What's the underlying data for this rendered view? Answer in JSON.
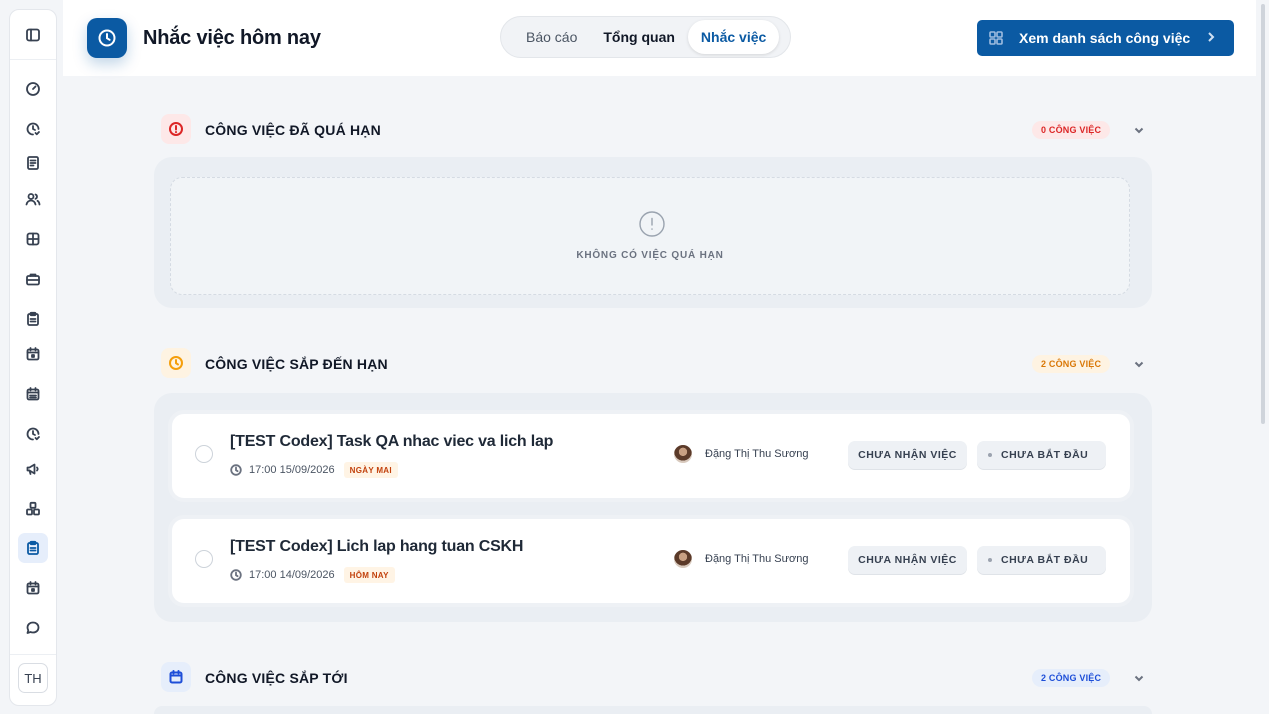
{
  "sidebar": {
    "icons": [
      "sidebar-toggle-icon",
      "dashboard-gauge-icon",
      "clock-check-icon",
      "document-icon",
      "users-icon",
      "layout-icon",
      "briefcase-icon",
      "clipboard-icon",
      "calendar-icon",
      "calendar-grid-icon",
      "clock-check-icon",
      "megaphone-icon",
      "cubes-icon",
      "clipboard-active-icon",
      "calendar-icon",
      "chat-icon"
    ],
    "avatar_initials": "TH"
  },
  "header": {
    "title": "Nhắc việc hôm nay",
    "tabs": [
      {
        "label": "Báo cáo"
      },
      {
        "label": "Tổng quan"
      },
      {
        "label": "Nhắc việc",
        "active": true
      }
    ],
    "list_button_label": "Xem danh sách công việc"
  },
  "sections": {
    "overdue": {
      "title": "CÔNG VIỆC ĐÃ QUÁ HẠN",
      "badge": "0 CÔNG VIỆC",
      "empty_text": "KHÔNG CÓ VIỆC QUÁ HẠN",
      "color": "#dc2626"
    },
    "due_soon": {
      "title": "CÔNG VIỆC SẮP ĐẾN HẠN",
      "badge": "2 CÔNG VIỆC",
      "color": "#f59e0b",
      "tasks": [
        {
          "name": "[TEST Codex] Task QA nhac viec va lich lap",
          "time": "17:00 15/09/2026",
          "tag": "NGÀY MAI",
          "assignee": "Đặng Thị Thu Sương",
          "status_accept": "CHƯA NHẬN VIỆC",
          "status_progress": "CHƯA BẮT ĐẦU"
        },
        {
          "name": "[TEST Codex] Lich lap hang tuan CSKH",
          "time": "17:00 14/09/2026",
          "tag": "HÔM NAY",
          "assignee": "Đặng Thị Thu Sương",
          "status_accept": "CHƯA NHẬN VIỆC",
          "status_progress": "CHƯA BẮT ĐẦU"
        }
      ]
    },
    "upcoming": {
      "title": "CÔNG VIỆC SẮP TỚI",
      "badge": "2 CÔNG VIỆC",
      "color": "#1d4ed8"
    }
  }
}
